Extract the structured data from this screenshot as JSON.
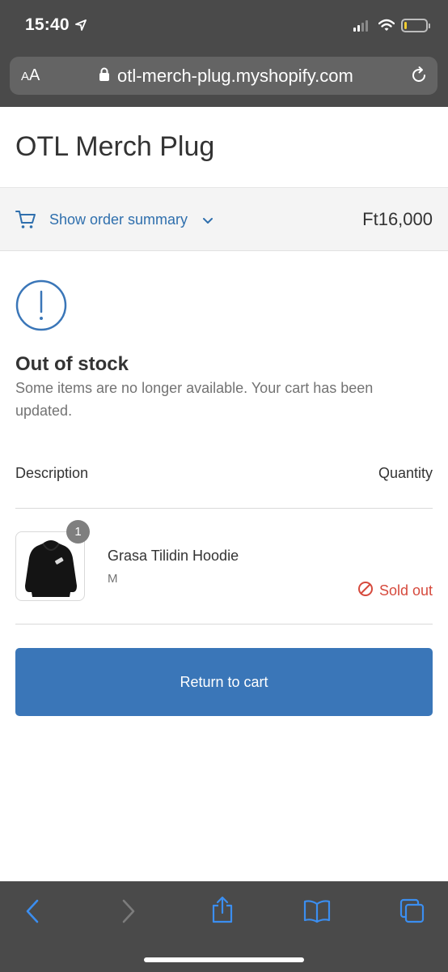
{
  "status_bar": {
    "time": "15:40",
    "location_icon": "location-arrow-icon",
    "signal_icon": "cellular-signal-icon",
    "wifi_icon": "wifi-icon",
    "battery_icon": "battery-icon",
    "battery_level": 0.1,
    "battery_color": "#f2cd31"
  },
  "browser": {
    "text_size_label": "AA",
    "url": "otl-merch-plug.myshopify.com",
    "lock_icon": "lock-icon",
    "reload_icon": "reload-icon"
  },
  "shop": {
    "name": "OTL Merch Plug"
  },
  "order_summary": {
    "toggle_label": "Show order summary",
    "total": "Ft16,000",
    "accent_color": "#2f6fad"
  },
  "notice": {
    "icon": "exclamation-circle-icon",
    "title": "Out of stock",
    "message": "Some items are no longer available. Your cart has been updated."
  },
  "table": {
    "headers": {
      "description": "Description",
      "quantity": "Quantity"
    },
    "items": [
      {
        "quantity_badge": "1",
        "name": "Grasa Tilidin Hoodie",
        "variant": "M",
        "status": "Sold out",
        "status_icon": "prohibited-icon",
        "status_color": "#d64a3d"
      }
    ]
  },
  "actions": {
    "return_label": "Return to cart",
    "button_color": "#3a76b8"
  },
  "toolbar": {
    "items": [
      "back-icon",
      "forward-icon",
      "share-icon",
      "bookmarks-icon",
      "tabs-icon"
    ]
  }
}
